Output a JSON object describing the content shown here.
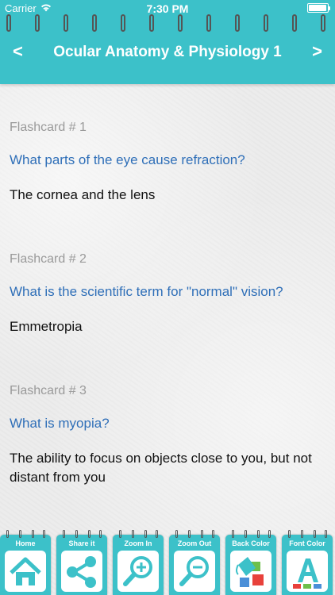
{
  "status_bar": {
    "carrier": "Carrier",
    "time": "7:30 PM",
    "wifi_icon": "wifi-icon",
    "battery_icon": "battery-icon"
  },
  "header": {
    "title": "Ocular Anatomy & Physiology 1",
    "prev_label": "<",
    "next_label": ">"
  },
  "colors": {
    "accent": "#3cc1c9",
    "question": "#2f6fb8",
    "label": "#9a9a9a"
  },
  "flashcards": [
    {
      "label": "Flashcard # 1",
      "question": "What parts of the eye cause refraction?",
      "answer": "The cornea and the lens"
    },
    {
      "label": "Flashcard # 2",
      "question": "What is the scientific term for \"normal\" vision?",
      "answer": "Emmetropia"
    },
    {
      "label": "Flashcard # 3",
      "question": "What is myopia?",
      "answer": "The ability to focus on objects close to you, but not distant from you"
    }
  ],
  "toolbar": {
    "items": [
      {
        "label": "Home",
        "icon": "home-icon"
      },
      {
        "label": "Share it",
        "icon": "share-icon"
      },
      {
        "label": "Zoom In",
        "icon": "zoom-in-icon"
      },
      {
        "label": "Zoom Out",
        "icon": "zoom-out-icon"
      },
      {
        "label": "Back Color",
        "icon": "paint-bucket-icon"
      },
      {
        "label": "Font Color",
        "icon": "font-letter-icon"
      }
    ]
  }
}
